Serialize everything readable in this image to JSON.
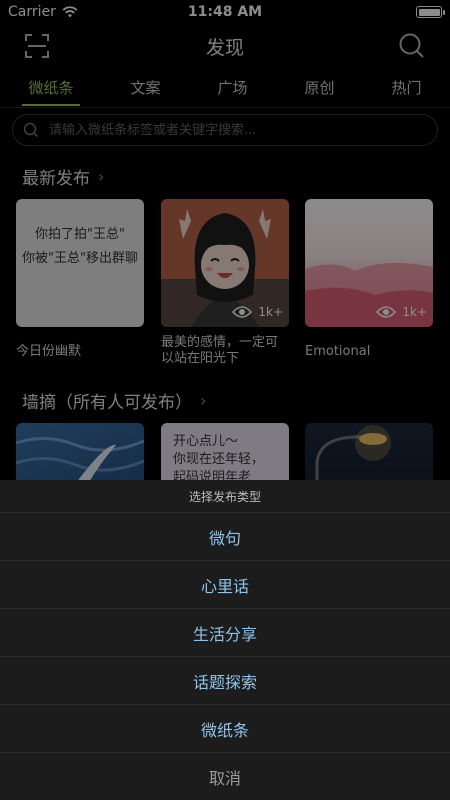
{
  "status": {
    "carrier": "Carrier",
    "time": "11:48 AM",
    "battery_level": 0.9
  },
  "nav": {
    "title": "发现"
  },
  "tabs": [
    {
      "label": "微纸条",
      "active": true
    },
    {
      "label": "文案",
      "active": false
    },
    {
      "label": "广场",
      "active": false
    },
    {
      "label": "原创",
      "active": false
    },
    {
      "label": "热门",
      "active": false
    }
  ],
  "search": {
    "placeholder": "请输入微纸条标签或者关键字搜索..."
  },
  "latest": {
    "title": "最新发布",
    "cards": [
      {
        "image_text": "你拍了拍\"王总\"\n你被\"王总\"移出群聊",
        "caption": "今日份幽默"
      },
      {
        "image_text": "",
        "caption": "最美的感情，一定可以站在阳光下",
        "views": "1k+"
      },
      {
        "image_text": "",
        "caption": "Emotional",
        "views": "1k+"
      }
    ]
  },
  "wall": {
    "title": "墙摘（所有人可发布）",
    "cards": [
      {
        "image_text": ""
      },
      {
        "image_text": "开心点儿～\n你现在还年轻，\n起码说明年老"
      },
      {
        "image_text": ""
      }
    ]
  },
  "sheet": {
    "title": "选择发布类型",
    "options": [
      "微句",
      "心里话",
      "生活分享",
      "话题探索",
      "微纸条"
    ],
    "cancel": "取消"
  },
  "colors": {
    "accent": "#9cc55b",
    "sheet_link": "#8fc3ec"
  }
}
